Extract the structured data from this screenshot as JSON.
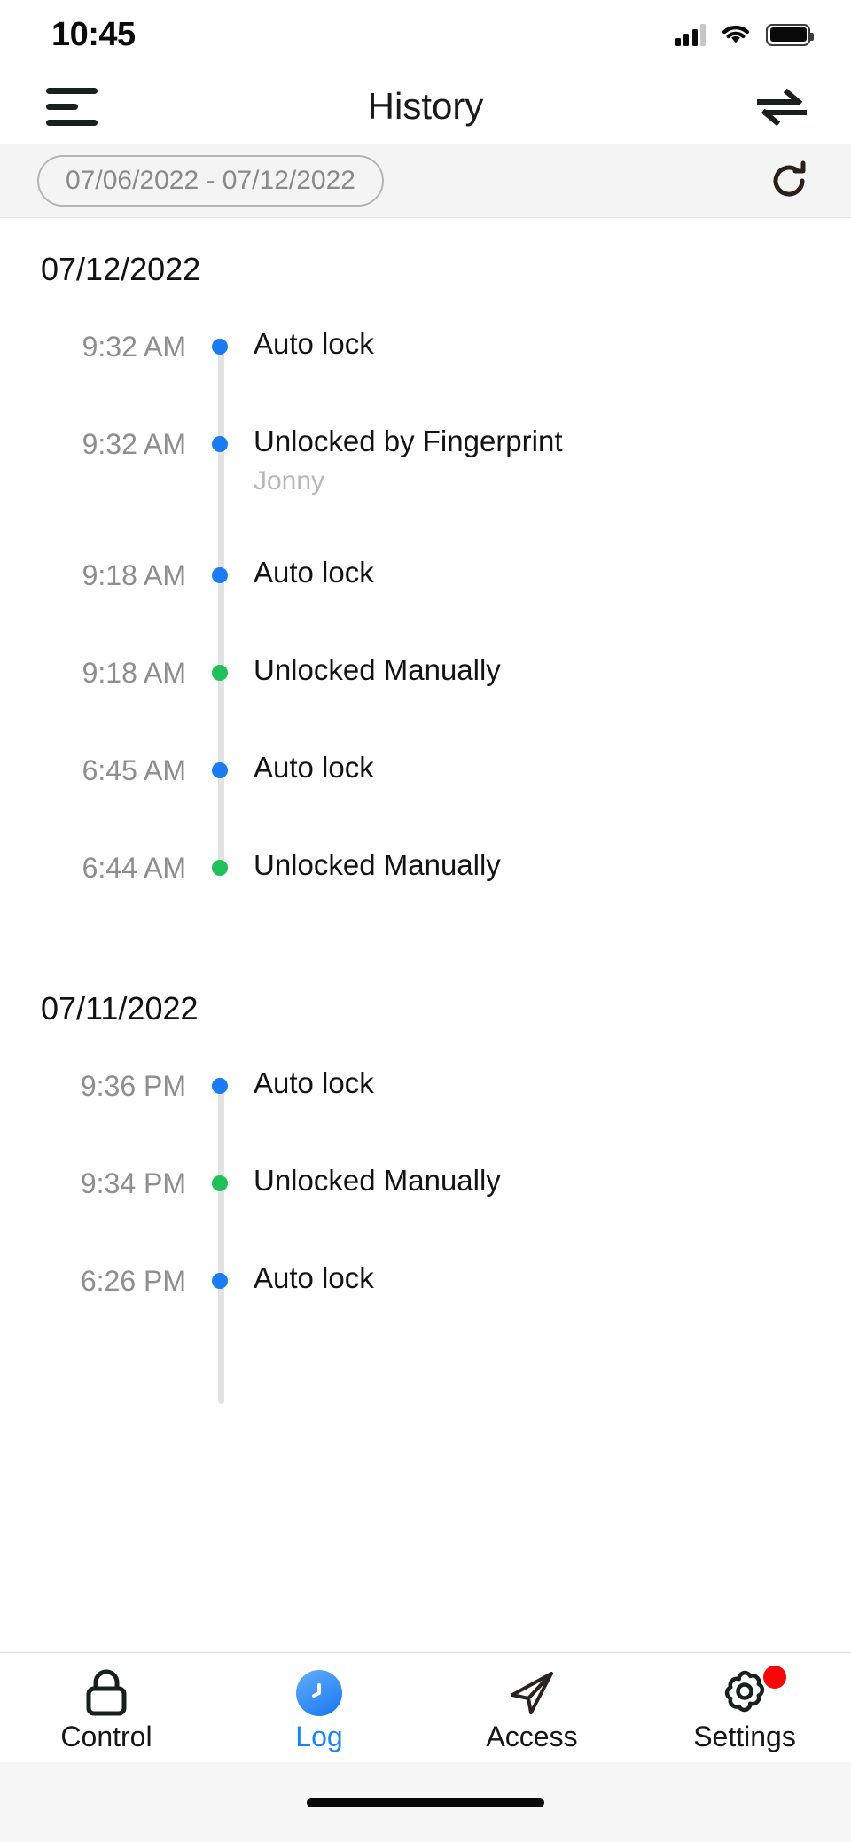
{
  "status_bar": {
    "time": "10:45",
    "signal_icon": "cellular-signal-icon",
    "wifi_icon": "wifi-icon",
    "battery_icon": "battery-icon"
  },
  "nav_bar": {
    "title": "History",
    "menu_icon": "hamburger-menu-icon",
    "swap_icon": "swap-arrows-icon"
  },
  "filter_bar": {
    "date_range": "07/06/2022 - 07/12/2022",
    "refresh_icon": "refresh-icon"
  },
  "colors": {
    "auto_lock_dot": "#1a7bf2",
    "manual_unlock_dot": "#21c15a",
    "accent": "#1a86f5",
    "badge": "#f70707"
  },
  "log": {
    "groups": [
      {
        "date": "07/12/2022",
        "entries": [
          {
            "time": "9:32 AM",
            "label": "Auto lock",
            "sub": "",
            "dot": "blue"
          },
          {
            "time": "9:32 AM",
            "label": "Unlocked by Fingerprint",
            "sub": "Jonny",
            "dot": "blue"
          },
          {
            "time": "9:18 AM",
            "label": "Auto lock",
            "sub": "",
            "dot": "blue"
          },
          {
            "time": "9:18 AM",
            "label": "Unlocked Manually",
            "sub": "",
            "dot": "green"
          },
          {
            "time": "6:45 AM",
            "label": "Auto lock",
            "sub": "",
            "dot": "blue"
          },
          {
            "time": "6:44 AM",
            "label": "Unlocked Manually",
            "sub": "",
            "dot": "green"
          }
        ]
      },
      {
        "date": "07/11/2022",
        "entries": [
          {
            "time": "9:36 PM",
            "label": "Auto lock",
            "sub": "",
            "dot": "blue"
          },
          {
            "time": "9:34 PM",
            "label": "Unlocked Manually",
            "sub": "",
            "dot": "green"
          },
          {
            "time": "6:26 PM",
            "label": "Auto lock",
            "sub": "",
            "dot": "blue"
          }
        ]
      }
    ]
  },
  "tab_bar": {
    "items": [
      {
        "label": "Control",
        "icon": "lock-icon",
        "active": false,
        "badge": false
      },
      {
        "label": "Log",
        "icon": "clock-icon",
        "active": true,
        "badge": false
      },
      {
        "label": "Access",
        "icon": "paper-plane-icon",
        "active": false,
        "badge": false
      },
      {
        "label": "Settings",
        "icon": "gear-icon",
        "active": false,
        "badge": true
      }
    ]
  }
}
